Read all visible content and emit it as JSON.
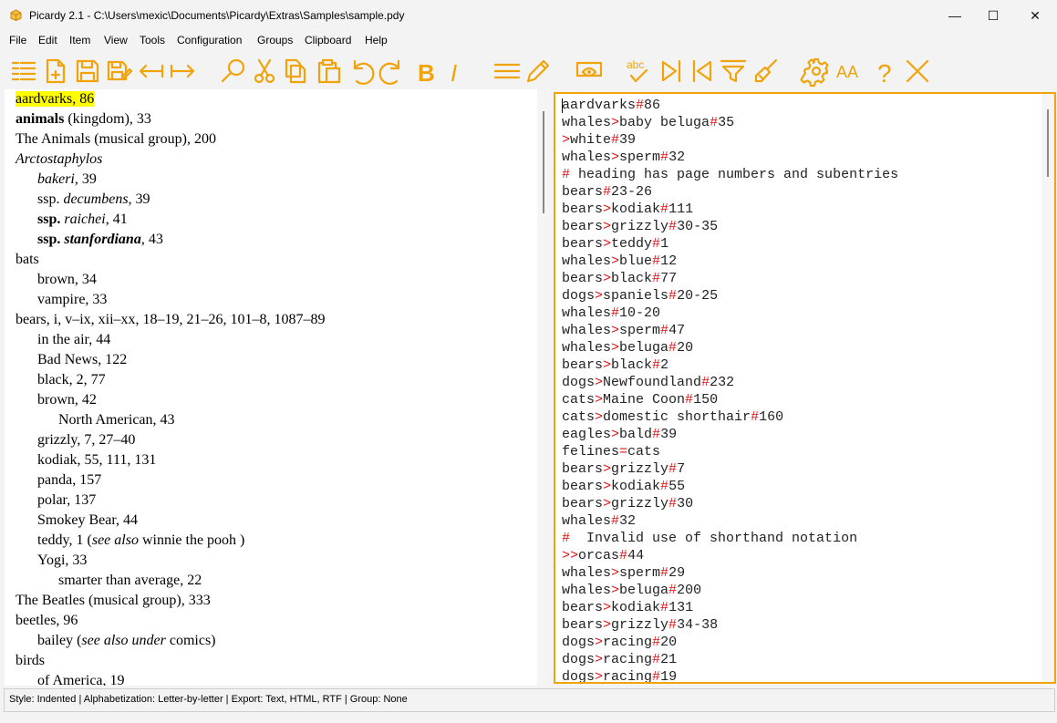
{
  "window": {
    "title": "Picardy 2.1 - C:\\Users\\mexic\\Documents\\Picardy\\Extras\\Samples\\sample.pdy",
    "minimize": "—",
    "maximize": "☐",
    "close": "✕"
  },
  "menu": [
    "File",
    "Edit",
    "Item",
    "View",
    "Tools",
    "Configuration",
    "Groups",
    "Clipboard",
    "Help"
  ],
  "toolbar": {
    "accent_color": "#f0a30a",
    "icons": [
      "list-icon",
      "new-document-icon",
      "save-icon",
      "save-all-icon",
      "arrow-left-icon",
      "arrow-right-icon",
      "search-icon",
      "cut-icon",
      "copy-icon",
      "paste-icon",
      "undo-icon",
      "redo-icon",
      "bold-icon",
      "italic-icon",
      "align-icon",
      "pencil-icon",
      "preview-icon",
      "spellcheck-icon",
      "next-icon",
      "previous-icon",
      "filter-icon",
      "clear-icon",
      "settings-icon",
      "font-size-icon",
      "help-icon",
      "close-icon"
    ],
    "bold_glyph": "B",
    "italic_glyph": "I",
    "spellcheck_text": "abc",
    "font_glyph": "AA",
    "help_glyph": "?"
  },
  "index_preview": [
    {
      "indent": 0,
      "highlight": true,
      "parts": [
        {
          "t": "aardvarks, 86"
        }
      ]
    },
    {
      "indent": 0,
      "parts": [
        {
          "t": "animals",
          "b": true
        },
        {
          "t": " (kingdom), 33"
        }
      ]
    },
    {
      "indent": 0,
      "parts": [
        {
          "t": "The Animals (musical group), 200"
        }
      ]
    },
    {
      "indent": 0,
      "parts": [
        {
          "t": "Arctostaphylos",
          "i": true
        }
      ]
    },
    {
      "indent": 1,
      "parts": [
        {
          "t": "bakeri",
          "i": true
        },
        {
          "t": ", 39"
        }
      ]
    },
    {
      "indent": 1,
      "parts": [
        {
          "t": "ssp. "
        },
        {
          "t": "decumbens",
          "i": true
        },
        {
          "t": ", 39"
        }
      ]
    },
    {
      "indent": 1,
      "parts": [
        {
          "t": "ssp. ",
          "b": true
        },
        {
          "t": "raichei",
          "i": true
        },
        {
          "t": ", 41"
        }
      ]
    },
    {
      "indent": 1,
      "parts": [
        {
          "t": "ssp. ",
          "b": true
        },
        {
          "t": "stanfordiana",
          "b": true,
          "i": true
        },
        {
          "t": ", 43"
        }
      ]
    },
    {
      "indent": 0,
      "parts": [
        {
          "t": "bats"
        }
      ]
    },
    {
      "indent": 1,
      "parts": [
        {
          "t": "brown, 34"
        }
      ]
    },
    {
      "indent": 1,
      "parts": [
        {
          "t": "vampire, 33"
        }
      ]
    },
    {
      "indent": 0,
      "parts": [
        {
          "t": "bears, i, v–ix, xii–xx, 18–19, 21–26, 101–8, 1087–89"
        }
      ]
    },
    {
      "indent": 1,
      "parts": [
        {
          "t": "in the air, 44"
        }
      ]
    },
    {
      "indent": 1,
      "parts": [
        {
          "t": "Bad News, 122"
        }
      ]
    },
    {
      "indent": 1,
      "parts": [
        {
          "t": "black, 2, 77"
        }
      ]
    },
    {
      "indent": 1,
      "parts": [
        {
          "t": "brown, 42"
        }
      ]
    },
    {
      "indent": 2,
      "parts": [
        {
          "t": "North American, 43"
        }
      ]
    },
    {
      "indent": 1,
      "parts": [
        {
          "t": "grizzly, 7, 27–40"
        }
      ]
    },
    {
      "indent": 1,
      "parts": [
        {
          "t": "kodiak, 55, 111, 131"
        }
      ]
    },
    {
      "indent": 1,
      "parts": [
        {
          "t": "panda, 157"
        }
      ]
    },
    {
      "indent": 1,
      "parts": [
        {
          "t": "polar, 137"
        }
      ]
    },
    {
      "indent": 1,
      "parts": [
        {
          "t": "Smokey Bear, 44"
        }
      ]
    },
    {
      "indent": 1,
      "parts": [
        {
          "t": "teddy, 1 ("
        },
        {
          "t": "see also",
          "i": true
        },
        {
          "t": " winnie the pooh )"
        }
      ]
    },
    {
      "indent": 1,
      "parts": [
        {
          "t": "Yogi, 33"
        }
      ]
    },
    {
      "indent": 2,
      "parts": [
        {
          "t": "smarter than average, 22"
        }
      ]
    },
    {
      "indent": 0,
      "parts": [
        {
          "t": "The Beatles (musical group), 333"
        }
      ]
    },
    {
      "indent": 0,
      "parts": [
        {
          "t": "beetles, 96"
        }
      ]
    },
    {
      "indent": 1,
      "parts": [
        {
          "t": "bailey ("
        },
        {
          "t": "see also under",
          "i": true
        },
        {
          "t": " comics)"
        }
      ]
    },
    {
      "indent": 0,
      "parts": [
        {
          "t": "birds"
        }
      ]
    },
    {
      "indent": 1,
      "parts": [
        {
          "t": "of America, 19"
        }
      ]
    }
  ],
  "editor_lines": [
    "aardvarks#86",
    "whales>baby beluga#35",
    ">white#39",
    "whales>sperm#32",
    "# heading has page numbers and subentries",
    "bears#23-26",
    "bears>kodiak#111",
    "bears>grizzly#30-35",
    "bears>teddy#1",
    "whales>blue#12",
    "bears>black#77",
    "dogs>spaniels#20-25",
    "whales#10-20",
    "whales>sperm#47",
    "whales>beluga#20",
    "bears>black#2",
    "dogs>Newfoundland#232",
    "cats>Maine Coon#150",
    "cats>domestic shorthair#160",
    "eagles>bald#39",
    "felines=cats",
    "bears>grizzly#7",
    "bears>kodiak#55",
    "bears>grizzly#30",
    "whales#32",
    "#  Invalid use of shorthand notation",
    ">>orcas#44",
    "whales>sperm#29",
    "whales>beluga#200",
    "bears>kodiak#131",
    "bears>grizzly#34-38",
    "dogs>racing#20",
    "dogs>racing#21",
    "dogs>racing#19"
  ],
  "status": "Style: Indented | Alphabetization: Letter-by-letter | Export: Text, HTML, RTF | Group: None",
  "colors": {
    "accent": "#f0a30a",
    "syntax_marker": "#e11111",
    "highlight": "#ffff00"
  }
}
